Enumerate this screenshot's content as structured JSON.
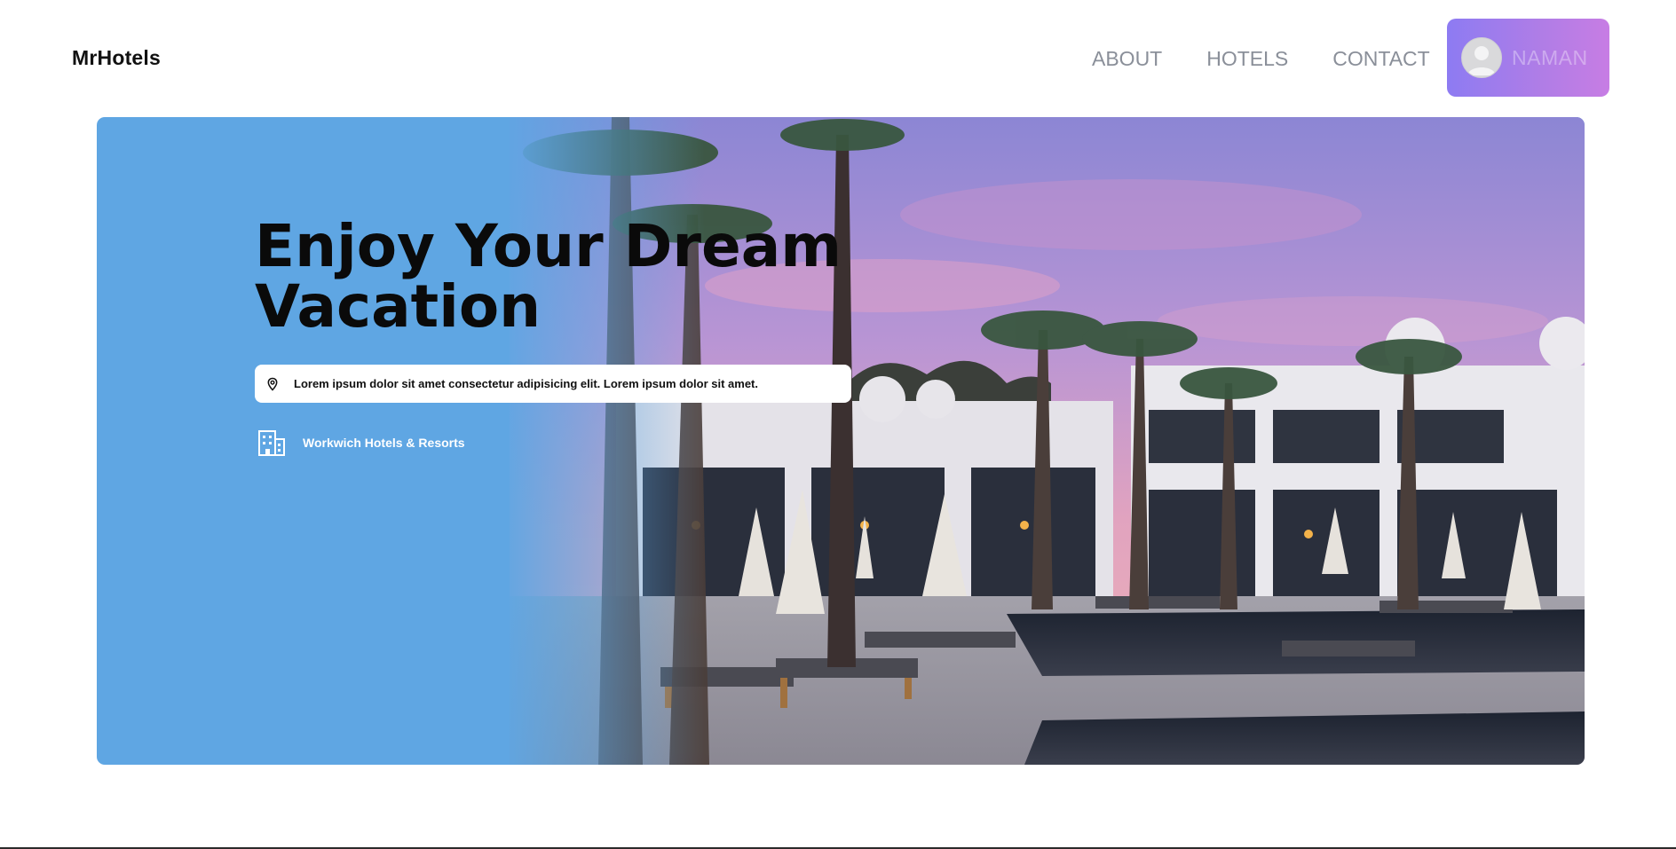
{
  "brand": {
    "name": "MrHotels"
  },
  "nav": {
    "links": [
      {
        "label": "ABOUT"
      },
      {
        "label": "HOTELS"
      },
      {
        "label": "CONTACT"
      }
    ]
  },
  "profile": {
    "name": "NAMAN",
    "icon": "user-avatar-icon"
  },
  "hero": {
    "title_line1": "Enjoy Your Dream",
    "title_line2": "Vacation",
    "location_text": "Lorem ipsum dolor sit amet consectetur adipisicing elit. Lorem ipsum dolor sit amet.",
    "location_icon": "map-pin-icon",
    "company_name": "Workwich Hotels & Resorts",
    "company_icon": "building-icon",
    "image": "resort-pool-palm-trees-sunset",
    "colors": {
      "panel": "#5fa6e3",
      "title": "#0a0a0a"
    }
  }
}
